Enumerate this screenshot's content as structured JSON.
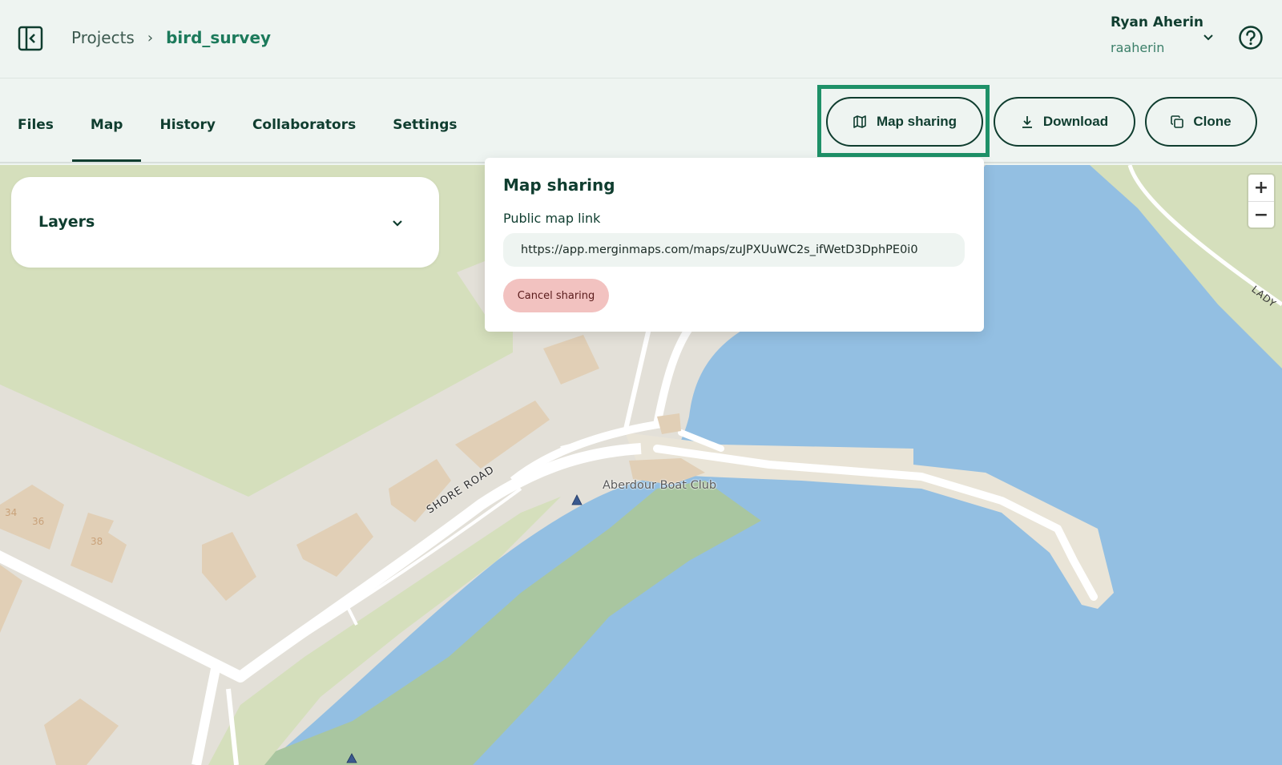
{
  "header": {
    "breadcrumb_root": "Projects",
    "breadcrumb_sep": "›",
    "project_name": "bird_survey",
    "user_name": "Ryan Aherin",
    "user_login": "raaherin"
  },
  "tabs": [
    {
      "label": "Files"
    },
    {
      "label": "Map",
      "active": true
    },
    {
      "label": "History"
    },
    {
      "label": "Collaborators"
    },
    {
      "label": "Settings"
    }
  ],
  "actions": {
    "share_label": "Map sharing",
    "download_label": "Download",
    "clone_label": "Clone"
  },
  "layers": {
    "title": "Layers"
  },
  "zoom": {
    "in": "+",
    "out": "−"
  },
  "popover": {
    "title": "Map sharing",
    "link_label": "Public map link",
    "link_value": "https://app.merginmaps.com/maps/zuJPXUuWC2s_ifWetD3DphPE0i0",
    "cancel_label": "Cancel sharing"
  },
  "map_labels": {
    "road": "SHORE ROAD",
    "poi": "Aberdour Boat Club",
    "edge_label": "LADY",
    "house_34": "34",
    "house_36": "36",
    "house_38": "38"
  },
  "colors": {
    "primary": "#0f3d2f",
    "accent": "#1e9168",
    "link_green": "#1c7a5b",
    "water": "#93bfe2",
    "land": "#e3e0d8",
    "park": "#d5dfbc",
    "woodland": "#a9c6a0",
    "building": "#e1cfb6",
    "cancel_bg": "#f2c2c0"
  }
}
